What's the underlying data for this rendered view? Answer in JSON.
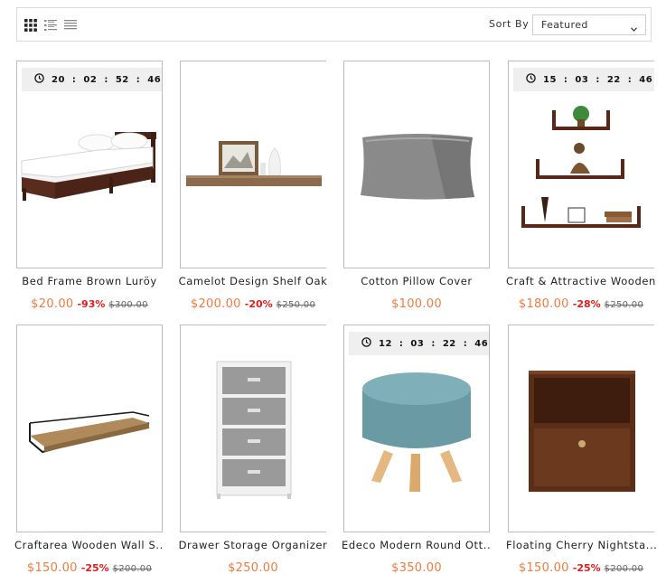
{
  "toolbar": {
    "sort_label": "Sort By",
    "sort_value": "Featured",
    "view_modes": [
      "grid-view-icon",
      "list-view-icon",
      "compact-list-icon"
    ]
  },
  "products": [
    {
      "title": "Bed Frame Brown Luröy",
      "price": "$20.00",
      "discount": "-93%",
      "old_price": "$300.00",
      "timer": {
        "h": "20",
        "m": "02",
        "s": "52",
        "ms": "46"
      }
    },
    {
      "title": "Camelot Design Shelf Oak",
      "price": "$200.00",
      "discount": "-20%",
      "old_price": "$250.00"
    },
    {
      "title": "Cotton Pillow Cover",
      "price": "$100.00"
    },
    {
      "title": "Craft & Attractive Wooden",
      "price": "$180.00",
      "discount": "-28%",
      "old_price": "$250.00",
      "timer": {
        "h": "15",
        "m": "03",
        "s": "22",
        "ms": "46"
      }
    },
    {
      "title": "Craftarea Wooden Wall S...",
      "price": "$150.00",
      "discount": "-25%",
      "old_price": "$200.00"
    },
    {
      "title": "Drawer Storage Organizer",
      "price": "$250.00"
    },
    {
      "title": "Edeco Modern Round Ott...",
      "price": "$350.00",
      "timer": {
        "h": "12",
        "m": "03",
        "s": "22",
        "ms": "46"
      }
    },
    {
      "title": "Floating Cherry Nightsta...",
      "price": "$150.00",
      "discount": "-25%",
      "old_price": "$200.00"
    }
  ],
  "colors": {
    "price": "#f07b3f",
    "discount": "#e21d1d",
    "border": "#bdbdbd"
  }
}
